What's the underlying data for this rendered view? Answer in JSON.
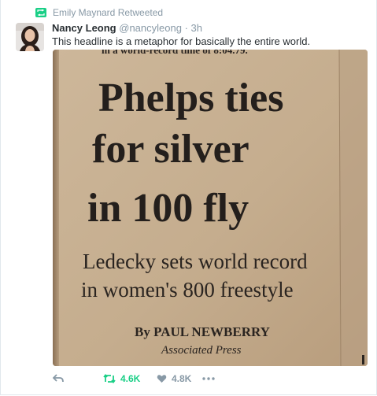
{
  "retweet_context": {
    "text": "Emily Maynard Retweeted",
    "accent": "#19cf86"
  },
  "author": {
    "name": "Nancy Leong",
    "handle": "@nancyleong",
    "separator": "·",
    "time": "3h"
  },
  "tweet_text": "This headline is a metaphor for basically the entire world.",
  "media": {
    "clipped_top_line": "in a world-record time of 8:04.79.",
    "headline_lines": [
      "Phelps ties",
      "for silver",
      "in 100 fly"
    ],
    "subhead_lines": [
      "Ledecky sets world record",
      "in women's 800 freestyle"
    ],
    "byline": "By PAUL NEWBERRY",
    "agency": "Associated Press"
  },
  "actions": {
    "reply_icon": "reply-icon",
    "retweet_icon": "retweet-icon",
    "retweet_count": "4.6K",
    "like_icon": "heart-icon",
    "like_count": "4.8K",
    "more_icon": "more-dots-icon"
  },
  "colors": {
    "meta_gray": "#8899a6",
    "text": "#292f33",
    "retweet_green": "#19cf86",
    "newsprint": "#c7b191"
  }
}
